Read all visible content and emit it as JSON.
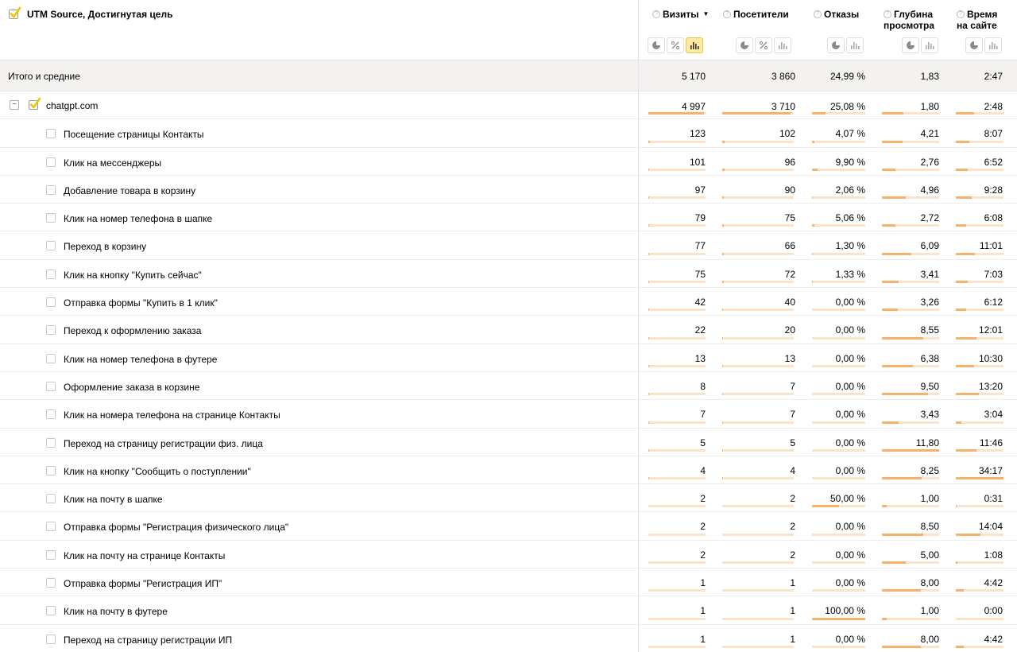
{
  "header": {
    "title": "UTM Source, Достигнутая цель",
    "columns": [
      {
        "label_line1": "Визиты",
        "label_line2": "",
        "sorted": true,
        "sort_icon": "▼"
      },
      {
        "label_line1": "Посетители",
        "label_line2": ""
      },
      {
        "label_line1": "Отказы",
        "label_line2": ""
      },
      {
        "label_line1": "Глубина",
        "label_line2": "просмотра"
      },
      {
        "label_line1": "Время",
        "label_line2": "на сайте"
      }
    ],
    "help_glyph": "?"
  },
  "total": {
    "label": "Итого и средние",
    "values": [
      "5 170",
      "3 860",
      "24,99 %",
      "1,83",
      "2:47"
    ]
  },
  "group": {
    "toggle": "−",
    "name": "chatgpt.com",
    "values": [
      "4 997",
      "3 710",
      "25,08 %",
      "1,80",
      "2:48"
    ],
    "bars": [
      0.97,
      0.96,
      0.25,
      0.37,
      0.38
    ]
  },
  "rows": [
    {
      "name": "Посещение страницы Контакты",
      "values": [
        "123",
        "102",
        "4,07 %",
        "4,21",
        "8:07"
      ],
      "bars": [
        0.03,
        0.03,
        0.04,
        0.36,
        0.29
      ]
    },
    {
      "name": "Клик на мессенджеры",
      "values": [
        "101",
        "96",
        "9,90 %",
        "2,76",
        "6:52"
      ],
      "bars": [
        0.02,
        0.03,
        0.1,
        0.23,
        0.25
      ]
    },
    {
      "name": "Добавление товара в корзину",
      "values": [
        "97",
        "90",
        "2,06 %",
        "4,96",
        "9:28"
      ],
      "bars": [
        0.02,
        0.02,
        0.02,
        0.42,
        0.34
      ]
    },
    {
      "name": "Клик на номер телефона в шапке",
      "values": [
        "79",
        "75",
        "5,06 %",
        "2,72",
        "6:08"
      ],
      "bars": [
        0.02,
        0.02,
        0.05,
        0.23,
        0.22
      ]
    },
    {
      "name": "Переход в корзину",
      "values": [
        "77",
        "66",
        "1,30 %",
        "6,09",
        "11:01"
      ],
      "bars": [
        0.02,
        0.02,
        0.01,
        0.52,
        0.4
      ]
    },
    {
      "name": "Клик на кнопку \"Купить сейчас\"",
      "values": [
        "75",
        "72",
        "1,33 %",
        "3,41",
        "7:03"
      ],
      "bars": [
        0.02,
        0.02,
        0.01,
        0.29,
        0.25
      ]
    },
    {
      "name": "Отправка формы \"Купить в 1 клик\"",
      "values": [
        "42",
        "40",
        "0,00 %",
        "3,26",
        "6:12"
      ],
      "bars": [
        0.01,
        0.01,
        0.0,
        0.28,
        0.22
      ]
    },
    {
      "name": "Переход к оформлению заказа",
      "values": [
        "22",
        "20",
        "0,00 %",
        "8,55",
        "12:01"
      ],
      "bars": [
        0.01,
        0.01,
        0.0,
        0.72,
        0.43
      ]
    },
    {
      "name": "Клик на номер телефона в футере",
      "values": [
        "13",
        "13",
        "0,00 %",
        "6,38",
        "10:30"
      ],
      "bars": [
        0.01,
        0.01,
        0.0,
        0.54,
        0.38
      ]
    },
    {
      "name": "Оформление заказа в корзине",
      "values": [
        "8",
        "7",
        "0,00 %",
        "9,50",
        "13:20"
      ],
      "bars": [
        0.01,
        0.01,
        0.0,
        0.8,
        0.48
      ]
    },
    {
      "name": "Клик на номера телефона на странице Контакты",
      "values": [
        "7",
        "7",
        "0,00 %",
        "3,43",
        "3:04"
      ],
      "bars": [
        0.01,
        0.01,
        0.0,
        0.29,
        0.11
      ]
    },
    {
      "name": "Переход на страницу регистрации физ. лица",
      "values": [
        "5",
        "5",
        "0,00 %",
        "11,80",
        "11:46"
      ],
      "bars": [
        0.01,
        0.01,
        0.0,
        1.0,
        0.43
      ]
    },
    {
      "name": "Клик на кнопку \"Сообщить о поступлении\"",
      "values": [
        "4",
        "4",
        "0,00 %",
        "8,25",
        "34:17"
      ],
      "bars": [
        0.01,
        0.01,
        0.0,
        0.7,
        1.0
      ]
    },
    {
      "name": "Клик на почту в шапке",
      "values": [
        "2",
        "2",
        "50,00 %",
        "1,00",
        "0:31"
      ],
      "bars": [
        0.0,
        0.0,
        0.5,
        0.08,
        0.02
      ]
    },
    {
      "name": "Отправка формы \"Регистрация физического лица\"",
      "values": [
        "2",
        "2",
        "0,00 %",
        "8,50",
        "14:04"
      ],
      "bars": [
        0.0,
        0.0,
        0.0,
        0.72,
        0.51
      ]
    },
    {
      "name": "Клик на почту на странице Контакты",
      "values": [
        "2",
        "2",
        "0,00 %",
        "5,00",
        "1:08"
      ],
      "bars": [
        0.0,
        0.0,
        0.0,
        0.42,
        0.04
      ]
    },
    {
      "name": "Отправка формы \"Регистрация ИП\"",
      "values": [
        "1",
        "1",
        "0,00 %",
        "8,00",
        "4:42"
      ],
      "bars": [
        0.0,
        0.0,
        0.0,
        0.68,
        0.17
      ]
    },
    {
      "name": "Клик на почту в футере",
      "values": [
        "1",
        "1",
        "100,00 %",
        "1,00",
        "0:00"
      ],
      "bars": [
        0.0,
        0.0,
        1.0,
        0.08,
        0.0
      ]
    },
    {
      "name": "Переход на страницу регистрации ИП",
      "values": [
        "1",
        "1",
        "0,00 %",
        "8,00",
        "4:42"
      ],
      "bars": [
        0.0,
        0.0,
        0.0,
        0.68,
        0.17
      ]
    }
  ],
  "colors": {
    "bar_fill": "#f6b26b",
    "bar_track": "#fbe3cb",
    "check": "#f2c200",
    "active_btn": "#ffeaa0"
  }
}
